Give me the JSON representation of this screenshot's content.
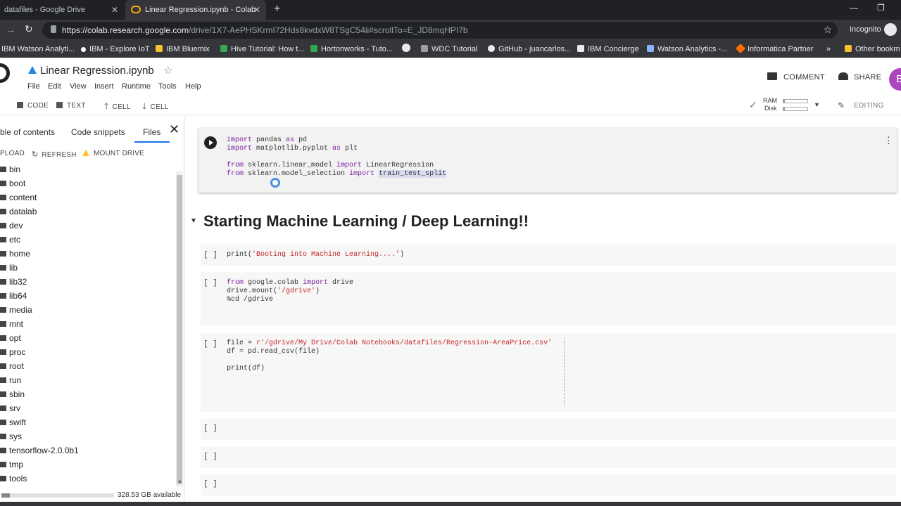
{
  "browser": {
    "tabs": [
      {
        "label": "datafiles - Google Drive"
      },
      {
        "label": "Linear Regression.ipynb - Colab"
      }
    ],
    "url_host": "https://colab.research.google.com",
    "url_path": "/drive/1X7-AePHSKrmI72Hds8kvdxW8TSgC54ii#scrollTo=E_JD8mqHPI7b",
    "profile": "Incognito"
  },
  "bookmarks": [
    {
      "label": "IBM Watson Analyti...",
      "color": "#4285f4"
    },
    {
      "label": "IBM - Explore IoT",
      "color": "#ffffff"
    },
    {
      "label": "IBM  Bluemix",
      "color": "#fbc02d"
    },
    {
      "label": "Hive Tutorial: How t...",
      "color": "#34a853"
    },
    {
      "label": "Hortonworks - Tuto...",
      "color": "#34a853"
    },
    {
      "label": "",
      "color": "#e8eaed"
    },
    {
      "label": "WDC Tutorial",
      "color": "#9e9e9e"
    },
    {
      "label": "GitHub - juancarlos...",
      "color": "#e8eaed"
    },
    {
      "label": "IBM Concierge",
      "color": "#e8eaed"
    },
    {
      "label": "Watson Analytics -...",
      "color": "#8ab4f8"
    },
    {
      "label": "Informatica Partner",
      "color": "#ff6d00"
    },
    {
      "label": "»",
      "color": ""
    },
    {
      "label": "Other bookm",
      "color": "#fbc02d"
    }
  ],
  "notebook": {
    "title": "Linear Regression.ipynb",
    "menu": [
      "File",
      "Edit",
      "View",
      "Insert",
      "Runtime",
      "Tools",
      "Help"
    ],
    "comment": "COMMENT",
    "share": "SHARE",
    "avatar": "B",
    "ram": "RAM",
    "disk": "Disk",
    "editing": "EDITING"
  },
  "toolbar": {
    "code": "CODE",
    "text": "TEXT",
    "cell_up": "CELL",
    "cell_down": "CELL"
  },
  "sidebar": {
    "tabs": [
      "ble of contents",
      "Code snippets",
      "Files"
    ],
    "upload": "PLOAD",
    "refresh": "REFRESH",
    "mount": "MOUNT DRIVE",
    "folders": [
      "bin",
      "boot",
      "content",
      "datalab",
      "dev",
      "etc",
      "home",
      "lib",
      "lib32",
      "lib64",
      "media",
      "mnt",
      "opt",
      "proc",
      "root",
      "run",
      "sbin",
      "srv",
      "swift",
      "sys",
      "tensorflow-2.0.0b1",
      "tmp",
      "tools"
    ],
    "storage": "328.53 GB available"
  },
  "cells": {
    "heading": "Starting Machine Learning / Deep Learning!!",
    "empty_bracket": "[ ]",
    "c1_l1a": "import",
    "c1_l1b": " pandas ",
    "c1_l1c": "as",
    "c1_l1d": " pd",
    "c1_l2a": "import",
    "c1_l2b": " matplotlib.pyplot ",
    "c1_l2c": "as",
    "c1_l2d": " plt",
    "c1_l3a": "from",
    "c1_l3b": " sklearn.linear_model ",
    "c1_l3c": "import",
    "c1_l3d": " LinearRegression",
    "c1_l4a": "from",
    "c1_l4b": " sklearn.model_selection ",
    "c1_l4c": "import",
    "c1_l4d": " ",
    "c1_l4e": "train_test_split",
    "c2_a": "print(",
    "c2_b": "'Booting into Machine Learning....'",
    "c2_c": ")",
    "c3_l1a": "from",
    "c3_l1b": " google.colab ",
    "c3_l1c": "import",
    "c3_l1d": " drive",
    "c3_l2a": "drive.mount(",
    "c3_l2b": "'/gdrive'",
    "c3_l2c": ")",
    "c3_l3": "%cd /gdrive",
    "c4_l1a": "file = ",
    "c4_l1b": "r'/gdrive/My Drive/Colab Notebooks/datafiles/Regression-AreaPrice.csv'",
    "c4_l2": "df = pd.read_csv(file)",
    "c4_l3": "print(df)"
  }
}
